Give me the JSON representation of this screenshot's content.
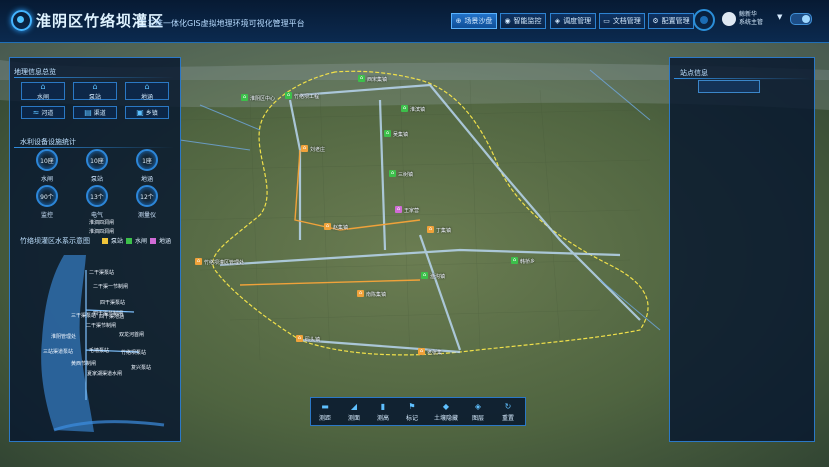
{
  "header": {
    "title": "淮阴区竹络坝灌区",
    "subtitle": "二三维一体化GIS虚拟地理环境可视化管理平台",
    "nav": [
      {
        "label": "场景沙盘",
        "icon": "globe-icon",
        "active": true
      },
      {
        "label": "智能监控",
        "icon": "camera-icon",
        "active": false
      },
      {
        "label": "调度管理",
        "icon": "schedule-icon",
        "active": false
      },
      {
        "label": "文档管理",
        "icon": "folder-icon",
        "active": false
      },
      {
        "label": "配置管理",
        "icon": "gear-icon",
        "active": false
      }
    ],
    "user_name": "鲸新华",
    "user_role": "系统主管"
  },
  "left_panel": {
    "geo_title": "地理信息总览",
    "categories": [
      {
        "label": "水闸",
        "icon": "sluice-icon"
      },
      {
        "label": "泵站",
        "icon": "pump-icon"
      },
      {
        "label": "地涵",
        "icon": "culvert-icon"
      },
      {
        "label": "河道",
        "icon": "river-icon"
      },
      {
        "label": "渠道",
        "icon": "canal-icon"
      },
      {
        "label": "乡镇",
        "icon": "town-icon"
      }
    ],
    "stats_title": "水利设备设施统计",
    "stats": [
      {
        "value": "10座",
        "label": "水闸"
      },
      {
        "value": "10座",
        "label": "泵站"
      },
      {
        "value": "1座",
        "label": "地涵"
      },
      {
        "value": "90个",
        "label": "监控"
      },
      {
        "value": "13个",
        "label": "电气"
      },
      {
        "value": "12个",
        "label": "测量仪"
      }
    ],
    "schematic_title": "竹络坝灌区水系示意图",
    "legend": [
      {
        "label": "泵站",
        "color": "#f0c53a"
      },
      {
        "label": "水闸",
        "color": "#3cc04a"
      },
      {
        "label": "地涵",
        "color": "#d06bd6"
      }
    ],
    "schematic_labels": [
      "淮泗四洞闸",
      "淮泗四洞闸",
      "二干渠泵站",
      "二干渠一节制闸",
      "四干渠泵站",
      "四干渠节制闸",
      "三干渠泵站",
      "四干渠地涵",
      "二干渠节制闸",
      "双龙河首闸",
      "淮阴管理处",
      "三站渠道泵站",
      "毛墙泵站",
      "竹络坝泵站",
      "复兴泵站",
      "黄西节制闸",
      "夏家湖渠道水闸"
    ]
  },
  "right_panel": {
    "title": "站点信息"
  },
  "toolbar": [
    {
      "label": "测距",
      "icon": "ruler-icon"
    },
    {
      "label": "测面",
      "icon": "area-icon"
    },
    {
      "label": "测高",
      "icon": "height-icon"
    },
    {
      "label": "标记",
      "icon": "flag-icon"
    },
    {
      "label": "土壤隐藏",
      "icon": "eye-icon"
    },
    {
      "label": "图层",
      "icon": "layers-icon"
    },
    {
      "label": "重置",
      "icon": "reset-icon"
    }
  ],
  "map_labels": [
    "西宋集镇",
    "淮阴区中心",
    "竹络坝工程",
    "淮滨镇",
    "吴集镇",
    "刘老庄",
    "竹络坝灌区管理处",
    "三树镇",
    "赵集镇",
    "王家营",
    "丁集镇",
    "韩桥乡",
    "渔沟镇",
    "南陈集镇",
    "码头镇",
    "老张集"
  ]
}
